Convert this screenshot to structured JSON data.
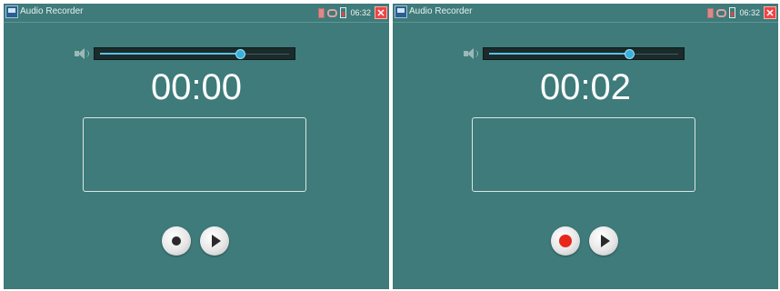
{
  "screens": [
    {
      "title": "Audio Recorder",
      "clock": "06:32",
      "close_label": "✕",
      "volume_level": 0.74,
      "time": "00:00",
      "recording": false,
      "icons": {
        "app": "audio-recorder-app-icon",
        "sim": "sim-card-icon",
        "link": "link-icon",
        "battery": "battery-icon",
        "speaker": "speaker-icon",
        "record": "record-icon",
        "play": "play-icon"
      }
    },
    {
      "title": "Audio Recorder",
      "clock": "06:32",
      "close_label": "✕",
      "volume_level": 0.74,
      "time": "00:02",
      "recording": true,
      "icons": {
        "app": "audio-recorder-app-icon",
        "sim": "sim-card-icon",
        "link": "link-icon",
        "battery": "battery-icon",
        "speaker": "speaker-icon",
        "record": "record-icon",
        "play": "play-icon"
      }
    }
  ],
  "colors": {
    "background": "#3e7b7a",
    "accent": "#3ab0dd",
    "record_active": "#e8261b",
    "close": "#e44444"
  }
}
